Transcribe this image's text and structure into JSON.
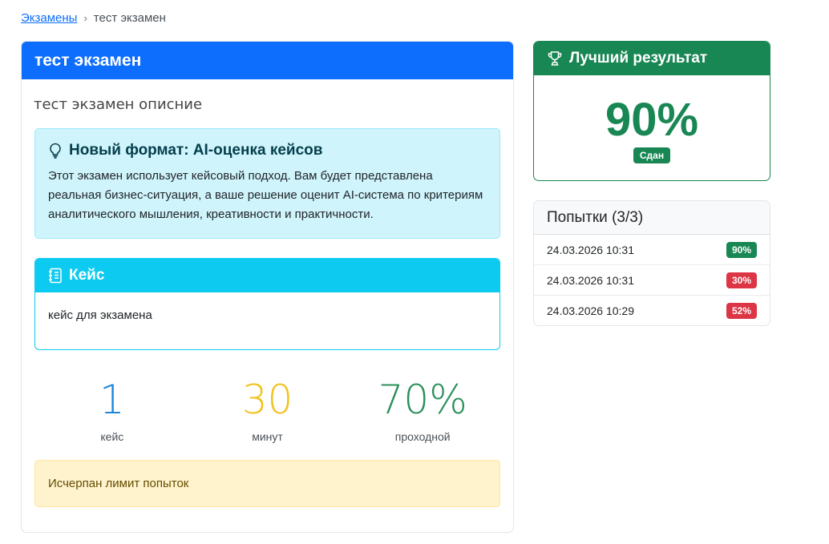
{
  "breadcrumb": {
    "parent": "Экзамены",
    "separator": "›",
    "current": "тест экзамен"
  },
  "exam": {
    "title": "тест экзамен",
    "description": "тест экзамен описние",
    "info": {
      "title": "Новый формат: AI-оценка кейсов",
      "text": "Этот экзамен использует кейсовый подход. Вам будет представлена реальная бизнес-ситуация, а ваше решение оценит AI-система по критериям аналитического мышления, креативности и практичности."
    },
    "case": {
      "title": "Кейс",
      "body": "кейс для экзамена"
    },
    "stats": [
      {
        "value": "1",
        "label": "кейс"
      },
      {
        "value": "30",
        "label": "минут"
      },
      {
        "value": "70%",
        "label": "проходной"
      }
    ],
    "warning": "Исчерпан лимит попыток"
  },
  "best": {
    "title": "Лучший результат",
    "value": "90%",
    "status": "Сдан"
  },
  "attempts": {
    "title": "Попытки (3/3)",
    "rows": [
      {
        "date": "24.03.2026 10:31",
        "score": "90%",
        "status": "success"
      },
      {
        "date": "24.03.2026 10:31",
        "score": "30%",
        "status": "danger"
      },
      {
        "date": "24.03.2026 10:29",
        "score": "52%",
        "status": "danger"
      }
    ]
  },
  "colors": {
    "primary": "#0d6efd",
    "info": "#0dcaf0",
    "success": "#198754",
    "danger": "#dc3545",
    "warning_bg": "#fff3cd"
  },
  "icons": {
    "info": "lightbulb-icon",
    "case": "journal-icon",
    "best": "trophy-icon"
  }
}
